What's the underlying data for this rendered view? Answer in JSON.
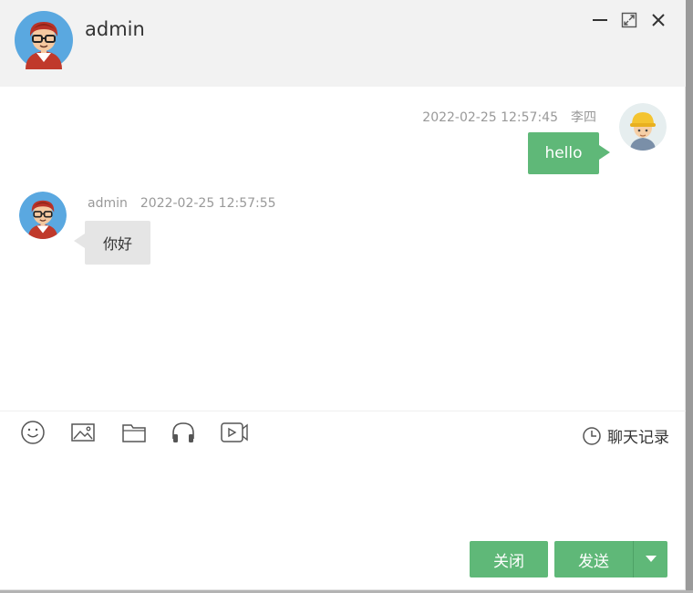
{
  "header": {
    "username": "admin",
    "controls": {
      "minimize": "minimize-icon",
      "maximize": "maximize-icon",
      "close": "close-icon"
    }
  },
  "messages": [
    {
      "direction": "out",
      "time": "2022-02-25 12:57:45",
      "sender": "李四",
      "text": "hello"
    },
    {
      "direction": "in",
      "sender": "admin",
      "time": "2022-02-25 12:57:55",
      "text": "你好"
    }
  ],
  "toolbar": {
    "icons": [
      "emoji-icon",
      "image-icon",
      "folder-icon",
      "headphones-icon",
      "video-icon"
    ],
    "history_label": "聊天记录"
  },
  "input": {
    "value": "",
    "placeholder": ""
  },
  "footer": {
    "close_label": "关闭",
    "send_label": "发送"
  },
  "colors": {
    "accent": "#5fb878",
    "header_bg": "#f2f2f2",
    "bubble_in": "#e5e5e5",
    "meta_text": "#999999"
  }
}
